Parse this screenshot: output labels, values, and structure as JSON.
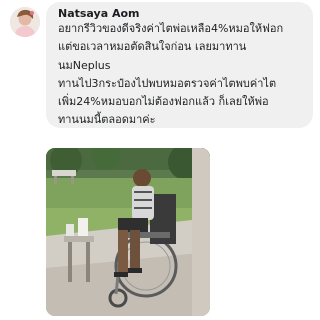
{
  "comment": {
    "author": "Natsaya Aom",
    "lines": [
      "อยากรีวิวของดีจริงค่าไตพ่อเหลือ4%หมอให้ฟอก",
      "แต่ขอเวลาหมอตัดสินใจก่อน เลยมาทาน",
      "นมNeplus",
      "ทานไป3กระป๋องไปพบหมอตรวจค่าไตพบค่าไต",
      "เพิ่ม24%หมอบอกไม่ต้องฟอกแล้ว ก็เลยให้พ่อ",
      "ทานนมนี้ตลอดมาค่ะ"
    ]
  },
  "colors": {
    "bubble": "#f0f0f0",
    "text": "#1c1e21"
  },
  "icons": {
    "avatar": "profile-photo"
  }
}
